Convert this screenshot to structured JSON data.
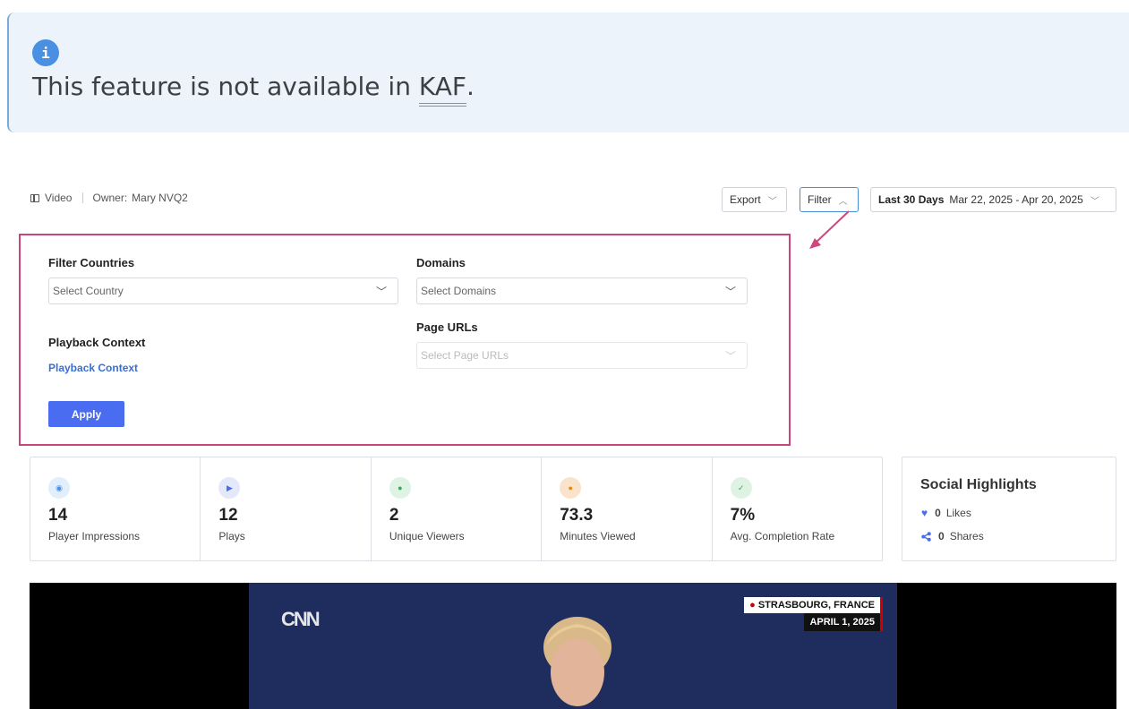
{
  "notice": {
    "message_prefix": "This feature is not available in ",
    "link_text": "KAF",
    "suffix": ".",
    "info_glyph": "i",
    "icon": "info-icon"
  },
  "breadcrumb": {
    "type": "Video",
    "owner_label": "Owner:",
    "owner_value": "Mary NVQ2"
  },
  "toolbar": {
    "export_label": "Export",
    "filter_label": "Filter",
    "range_label": "Last 30 Days",
    "range_value": "Mar 22, 2025 - Apr 20, 2025"
  },
  "filters": {
    "countries_label": "Filter Countries",
    "countries_placeholder": "Select Country",
    "domains_label": "Domains",
    "domains_placeholder": "Select Domains",
    "page_urls_label": "Page URLs",
    "page_urls_placeholder": "Select Page URLs",
    "playback_label": "Playback Context",
    "playback_link": "Playback Context",
    "apply_label": "Apply"
  },
  "stats": [
    {
      "value": "14",
      "label": "Player Impressions",
      "icon": "eye-icon",
      "color": "#4a90e2",
      "bg": "#e1eefb",
      "glyph": "◉"
    },
    {
      "value": "12",
      "label": "Plays",
      "icon": "play-icon",
      "color": "#4a6cf0",
      "bg": "#e3e8fb",
      "glyph": "▶"
    },
    {
      "value": "2",
      "label": "Unique Viewers",
      "icon": "user-icon",
      "color": "#3aa55c",
      "bg": "#def3e4",
      "glyph": "●"
    },
    {
      "value": "73.3",
      "label": "Minutes Viewed",
      "icon": "clock-icon",
      "color": "#e08a1e",
      "bg": "#f9e4cb",
      "glyph": "●"
    },
    {
      "value": "7%",
      "label": "Avg. Completion Rate",
      "icon": "check-icon",
      "color": "#3aa55c",
      "bg": "#def3e4",
      "glyph": "✓"
    }
  ],
  "social": {
    "title": "Social Highlights",
    "likes_count": "0",
    "likes_label": "Likes",
    "shares_count": "0",
    "shares_label": "Shares",
    "accent": "#4a6cf0"
  },
  "video": {
    "channel": "CNN",
    "location": "STRASBOURG, FRANCE",
    "date": "APRIL 1, 2025"
  }
}
